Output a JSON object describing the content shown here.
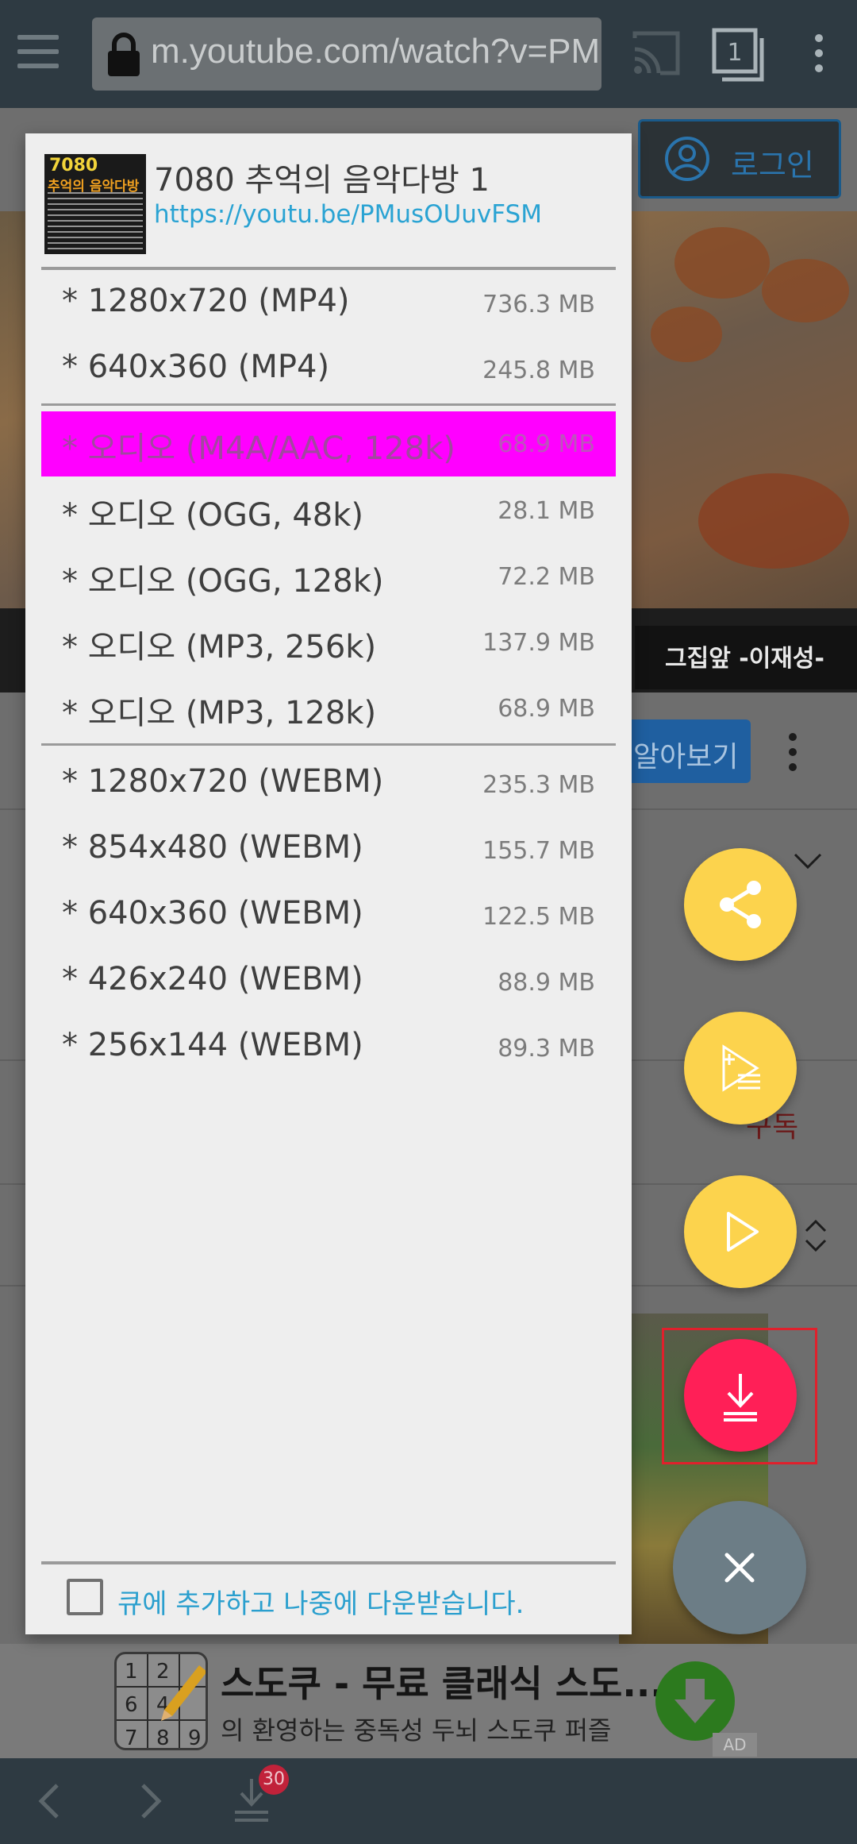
{
  "toolbar": {
    "url": "m.youtube.com/watch?v=PMusOUuvFSM",
    "tab_count": "1"
  },
  "background_page": {
    "login_label": "로그인",
    "caption": "그집앞 -이재성-",
    "learn_more_label": "알아보기",
    "subscribe_fragment": "구독"
  },
  "dialog": {
    "title": "7080 추억의 음악다방 1",
    "url": "https://youtu.be/PMusOUuvFSM",
    "thumbnail_text_1": "7080",
    "thumbnail_text_2": "추억의 음악다방",
    "video_options": [
      {
        "label": "* 1280x720 (MP4)",
        "size": "736.3 MB"
      },
      {
        "label": "* 640x360 (MP4)",
        "size": "245.8 MB"
      }
    ],
    "audio_options": [
      {
        "label": "* 오디오 (M4A/AAC, 128k)",
        "size": "68.9 MB",
        "selected": true
      },
      {
        "label": "* 오디오 (OGG, 48k)",
        "size": "28.1 MB"
      },
      {
        "label": "* 오디오 (OGG, 128k)",
        "size": "72.2 MB"
      },
      {
        "label": "* 오디오 (MP3, 256k)",
        "size": "137.9 MB"
      },
      {
        "label": "* 오디오 (MP3, 128k)",
        "size": "68.9 MB"
      }
    ],
    "webm_options": [
      {
        "label": "* 1280x720 (WEBM)",
        "size": "235.3 MB"
      },
      {
        "label": "* 854x480 (WEBM)",
        "size": "155.7 MB"
      },
      {
        "label": "* 640x360 (WEBM)",
        "size": "122.5 MB"
      },
      {
        "label": "* 426x240 (WEBM)",
        "size": "88.9 MB"
      },
      {
        "label": "* 256x144 (WEBM)",
        "size": "89.3 MB"
      }
    ],
    "queue_checkbox_label": "큐에 추가하고 나중에 다운받습니다.",
    "queue_checked": false
  },
  "fabs": [
    "share-icon",
    "playlist-add-icon",
    "play-icon",
    "download-icon",
    "close-icon"
  ],
  "ad": {
    "title": "스도쿠 - 무료 클래식 스도...",
    "subtitle": "의 환영하는 중독성 두뇌 스도쿠 퍼즐",
    "tag": "AD"
  },
  "bottom_nav": {
    "download_count": "30"
  },
  "colors": {
    "toolbar_bg": "#2e3a42",
    "selected_option": "#ff00ff",
    "fab_yellow": "#fcd34d",
    "fab_download": "#ff1f57",
    "fab_close": "#6c7d86",
    "link_blue": "#2aa3d3"
  }
}
